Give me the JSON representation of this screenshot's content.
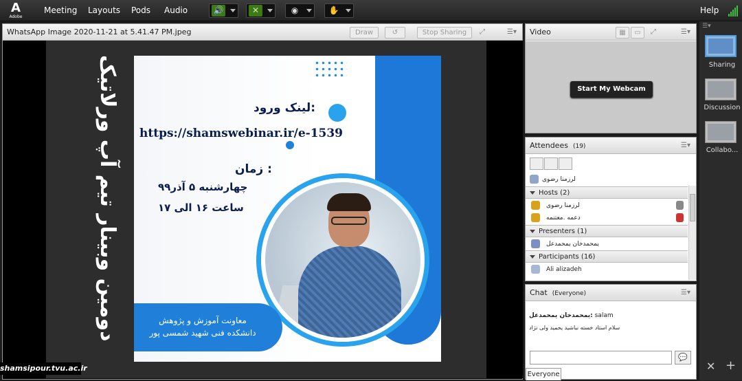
{
  "app": {
    "logo_text": "Adobe",
    "menus": [
      "Meeting",
      "Layouts",
      "Pods",
      "Audio"
    ],
    "help_label": "Help"
  },
  "share_pod": {
    "title": "WhatsApp Image 2020-11-21 at 5.41.47 PM.jpeg",
    "draw_label": "Draw",
    "stop_sharing_label": "Stop Sharing"
  },
  "slide": {
    "vertical_title": "دومین وبینار تیم آپ ورلاتیک",
    "link_label": "لینک ورود:",
    "url": "https://shamswebinar.ir/e-1539",
    "time_label": "زمان :",
    "date": "چهارشنبه ۵ آذر۹۹",
    "hours": "ساعت ۱۶ الی ۱۷",
    "banner_line1": "معاونت آموزش و پژوهش",
    "banner_line2": "دانشکده فنی شهید شمسی پور",
    "watermark": "shamsipour.tvu.ac.ir"
  },
  "video_pod": {
    "title": "Video",
    "start_webcam_label": "Start My Webcam"
  },
  "attendees_pod": {
    "title": "Attendees",
    "count": "(19)",
    "me_name": "لرزمنا رضوی",
    "groups": {
      "hosts": {
        "label": "Hosts (2)",
        "members": [
          "لرزمنا رضوی",
          "دعمه .معتنمه"
        ]
      },
      "presenters": {
        "label": "Presenters (1)",
        "members": [
          "یمحمدخان یمحمدعل"
        ]
      },
      "participants": {
        "label": "Participants (16)",
        "members": [
          "Ali alizadeh"
        ]
      }
    }
  },
  "chat_pod": {
    "title": "Chat",
    "scope": "(Everyone)",
    "messages": [
      {
        "sender": "یمحمدخان یمحمدعل:",
        "text": " salam"
      },
      {
        "sender": "",
        "text": "سلام استاد خسته نباشید یحمید ولی نژاد"
      }
    ],
    "footer_tab": "Everyone"
  },
  "layouts_bar": {
    "items": [
      "Sharing",
      "Discussion",
      "Collabo..."
    ]
  },
  "colors": {
    "accent_blue": "#1e78d8",
    "mic_green": "#3d7a16",
    "signal_green": "#3fc13f"
  }
}
